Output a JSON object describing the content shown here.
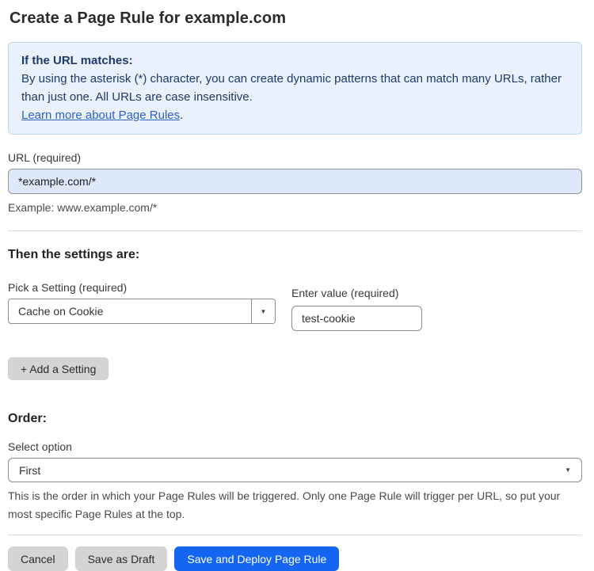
{
  "page": {
    "title": "Create a Page Rule for example.com"
  },
  "info_box": {
    "heading": "If the URL matches:",
    "body": "By using the asterisk (*) character, you can create dynamic patterns that can match many URLs, rather than just one. All URLs are case insensitive.",
    "link_label": "Learn more about Page Rules",
    "link_suffix": "."
  },
  "url_field": {
    "label": "URL (required)",
    "value": "*example.com/*",
    "example": "Example: www.example.com/*"
  },
  "settings": {
    "heading": "Then the settings are:",
    "setting_label": "Pick a Setting (required)",
    "setting_value": "Cache on Cookie",
    "caret_glyph": "▼",
    "value_label": "Enter value (required)",
    "value_value": "test-cookie",
    "add_button_label": "+ Add a Setting"
  },
  "order": {
    "heading": "Order:",
    "label": "Select option",
    "value": "First",
    "caret_glyph": "▼",
    "help": "This is the order in which your Page Rules will be triggered. Only one Page Rule will trigger per URL, so put your most specific Page Rules at the top."
  },
  "footer": {
    "cancel_label": "Cancel",
    "save_draft_label": "Save as Draft",
    "save_deploy_label": "Save and Deploy Page Rule"
  },
  "colors": {
    "primary_blue": "#1466f2",
    "info_bg": "#e9f2fc",
    "info_border": "#b9d8f3",
    "info_text": "#1f3a68",
    "link_blue": "#2f61c1",
    "url_input_bg": "#dde9fb",
    "gray_button_bg": "#d4d4d4"
  }
}
